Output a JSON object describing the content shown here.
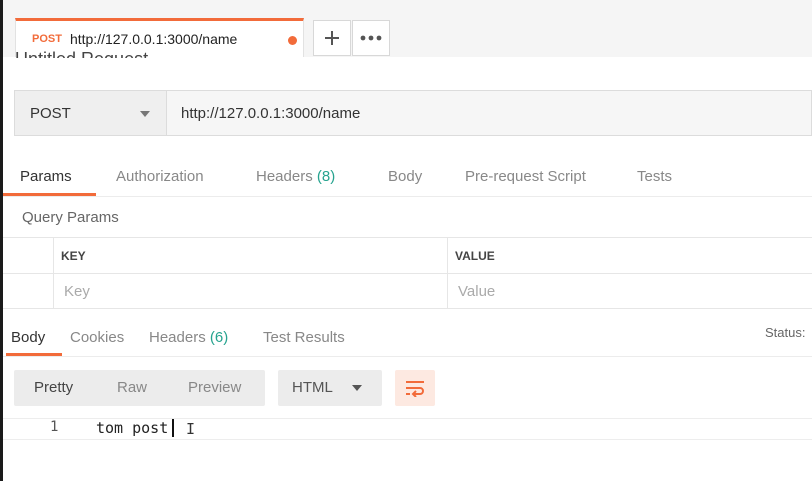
{
  "tab": {
    "method": "POST",
    "url": "http://127.0.0.1:3000/name"
  },
  "tab_actions": {
    "add_icon": "plus-icon",
    "more_icon": "more-horizontal-icon"
  },
  "request_title": "Untitled Request",
  "request": {
    "method": "POST",
    "url": "http://127.0.0.1:3000/name"
  },
  "request_tabs": {
    "params": "Params",
    "authorization": "Authorization",
    "headers": "Headers",
    "headers_count": "(8)",
    "body": "Body",
    "prerequest": "Pre-request Script",
    "tests": "Tests"
  },
  "query_params": {
    "title": "Query Params",
    "key_header": "KEY",
    "value_header": "VALUE",
    "key_placeholder": "Key",
    "value_placeholder": "Value"
  },
  "response_tabs": {
    "body": "Body",
    "cookies": "Cookies",
    "headers": "Headers",
    "headers_count": "(6)",
    "test_results": "Test Results",
    "status": "Status:"
  },
  "body_toolbar": {
    "pretty": "Pretty",
    "raw": "Raw",
    "preview": "Preview",
    "format": "HTML"
  },
  "response_body": {
    "line_number": "1",
    "text": "tom post"
  },
  "colors": {
    "accent": "#f26b3a",
    "count_green": "#26a38f"
  }
}
